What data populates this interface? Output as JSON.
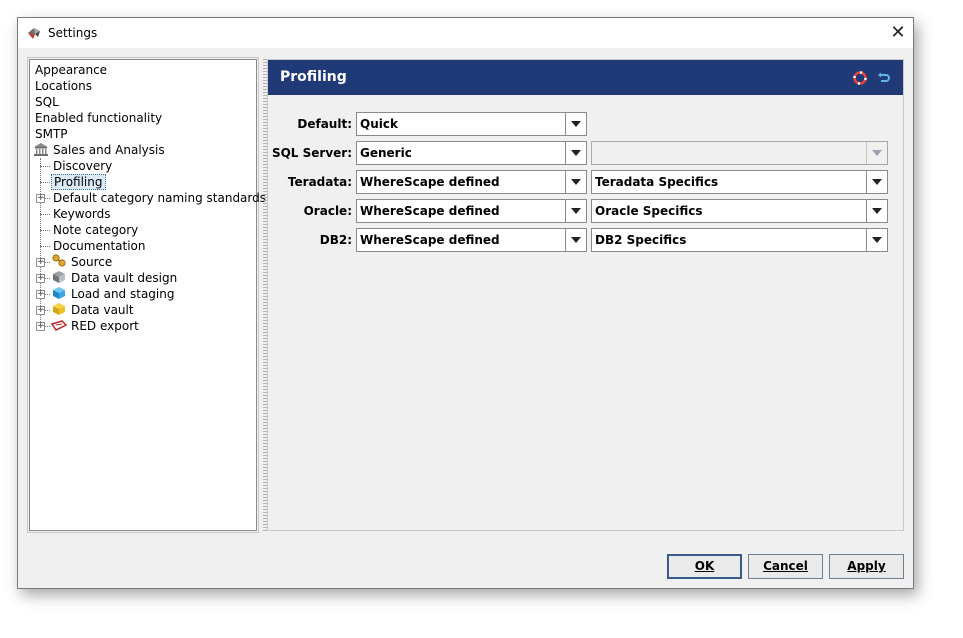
{
  "window": {
    "title": "Settings",
    "close_glyph": "✕"
  },
  "tree": {
    "items": [
      {
        "label": "Appearance"
      },
      {
        "label": "Locations"
      },
      {
        "label": "SQL"
      },
      {
        "label": "Enabled functionality"
      },
      {
        "label": "SMTP"
      },
      {
        "label": "Sales and Analysis",
        "icon": "bank-icon"
      },
      {
        "label": "Discovery"
      },
      {
        "label": "Profiling",
        "selected": true
      },
      {
        "label": "Default category naming standards"
      },
      {
        "label": "Keywords"
      },
      {
        "label": "Note category"
      },
      {
        "label": "Documentation"
      },
      {
        "label": "Source",
        "icon": "source-icon"
      },
      {
        "label": "Data vault design",
        "icon": "data-vault-design-icon"
      },
      {
        "label": "Load and staging",
        "icon": "load-staging-icon"
      },
      {
        "label": "Data vault",
        "icon": "data-vault-icon"
      },
      {
        "label": "RED export",
        "icon": "red-export-icon"
      }
    ]
  },
  "panel": {
    "title": "Profiling",
    "header_icons": [
      "lifebuoy-icon",
      "undo-icon"
    ],
    "rows": [
      {
        "label": "Default:",
        "value": "Quick",
        "value2": null
      },
      {
        "label": "SQL Server:",
        "value": "Generic",
        "value2": ""
      },
      {
        "label": "Teradata:",
        "value": "WhereScape defined",
        "value2": "Teradata Specifics"
      },
      {
        "label": "Oracle:",
        "value": "WhereScape defined",
        "value2": "Oracle Specifics"
      },
      {
        "label": "DB2:",
        "value": "WhereScape defined",
        "value2": "DB2 Specifics"
      }
    ]
  },
  "buttons": {
    "ok": "OK",
    "cancel": "Cancel",
    "apply": "Apply"
  },
  "colors": {
    "header_bg": "#203a78",
    "selection": "#dce9f7"
  }
}
